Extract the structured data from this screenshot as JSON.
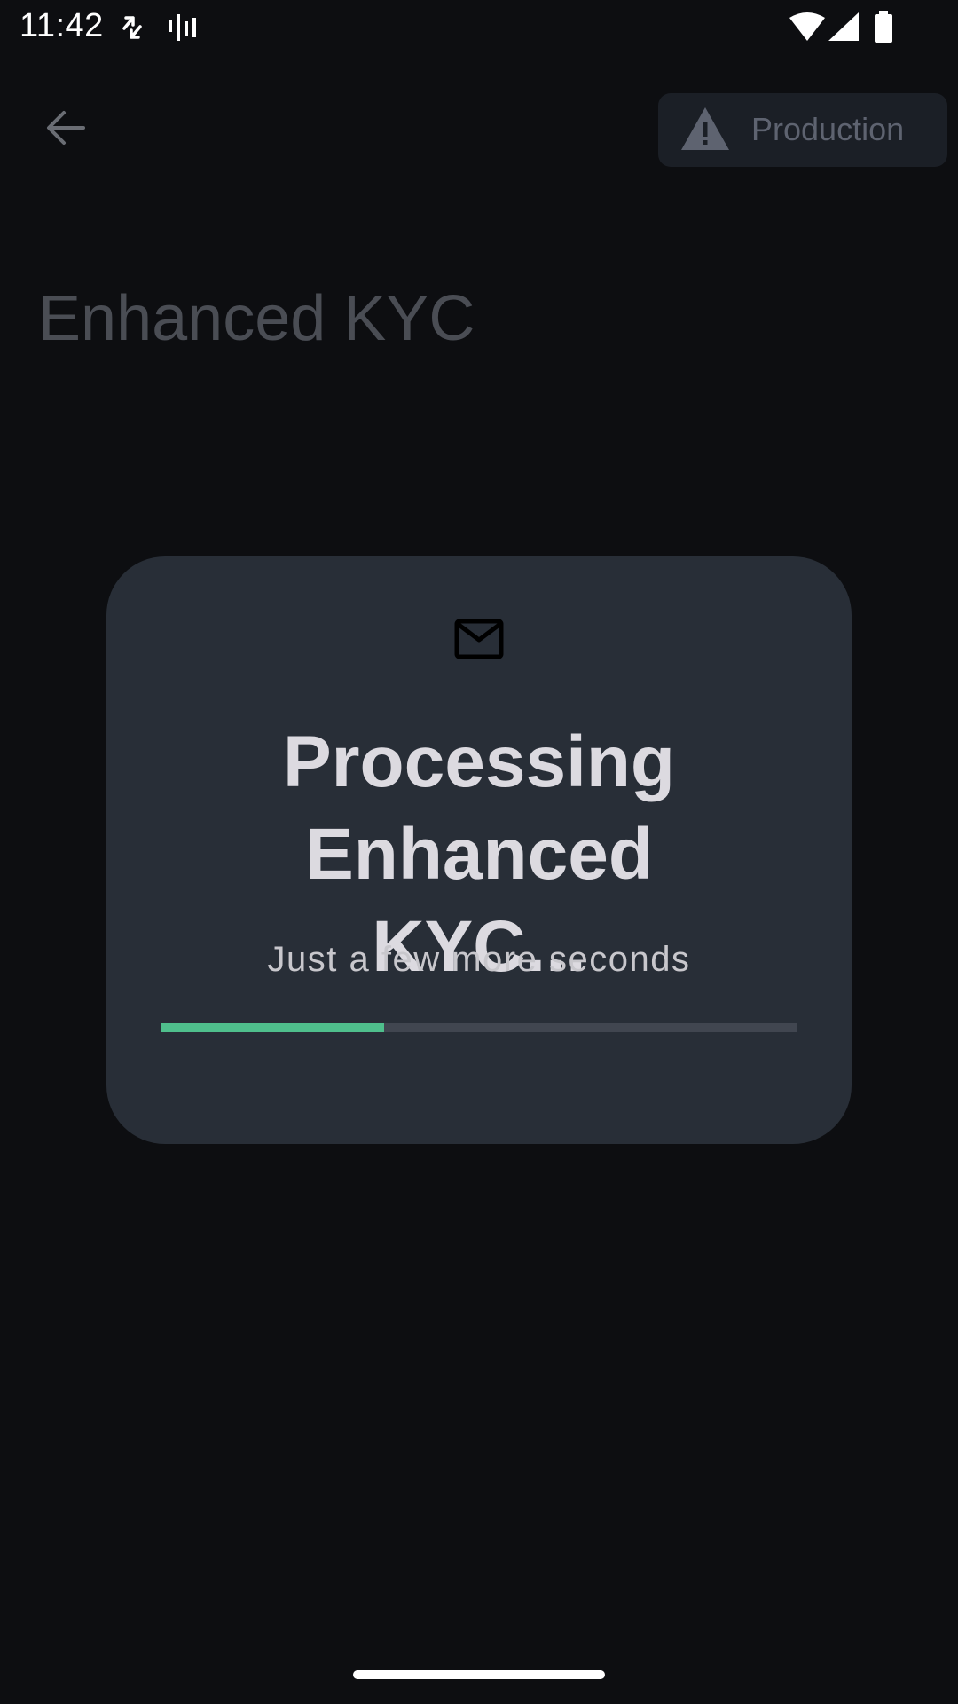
{
  "status_bar": {
    "time": "11:42",
    "icons": [
      "sync-arrows-icon",
      "signal-bars-icon",
      "wifi-icon",
      "cellular-icon",
      "battery-icon"
    ]
  },
  "header": {
    "back_icon": "arrow-left-icon",
    "environment_label": "Production",
    "environment_icon": "warning-triangle-icon"
  },
  "page": {
    "title": "Enhanced KYC"
  },
  "modal": {
    "icon": "mail-icon",
    "title": "Processing Enhanced KYC...",
    "subtitle": "Just a few more seconds",
    "progress_percent": 35
  },
  "colors": {
    "background": "#0d0e11",
    "card": "#282e37",
    "accent": "#4fbf8c",
    "track": "#414650"
  }
}
